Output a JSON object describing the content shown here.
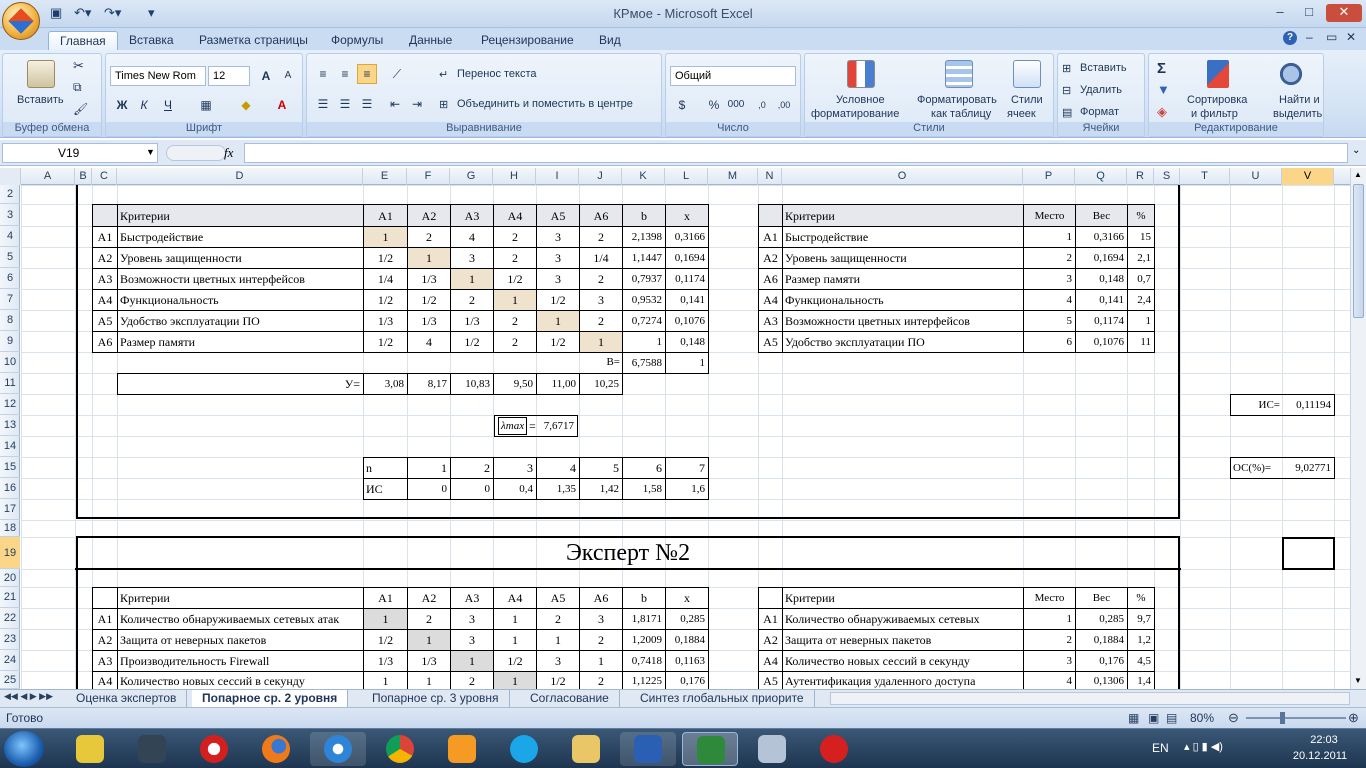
{
  "window": {
    "title": "КРмое - Microsoft Excel"
  },
  "ribbon": {
    "tabs": [
      "Главная",
      "Вставка",
      "Разметка страницы",
      "Формулы",
      "Данные",
      "Рецензирование",
      "Вид"
    ],
    "clipboard": {
      "paste": "Вставить",
      "group": "Буфер обмена"
    },
    "font": {
      "name": "Times New Rom",
      "size": "12",
      "bold": "Ж",
      "italic": "К",
      "underline": "Ч",
      "group": "Шрифт"
    },
    "align": {
      "wrap": "Перенос текста",
      "merge": "Объединить и поместить в центре",
      "group": "Выравнивание"
    },
    "number": {
      "format": "Общий",
      "percent": "%",
      "thousands": "000",
      "group": "Число"
    },
    "styles": {
      "cond1": "Условное",
      "cond2": "форматирование",
      "table1": "Форматировать",
      "table2": "как таблицу",
      "cell1": "Стили",
      "cell2": "ячеек",
      "group": "Стили"
    },
    "cells": {
      "insert": "Вставить",
      "delete": "Удалить",
      "format": "Формат",
      "group": "Ячейки"
    },
    "edit": {
      "sort1": "Сортировка",
      "sort2": "и фильтр",
      "find1": "Найти и",
      "find2": "выделить",
      "group": "Редактирование"
    }
  },
  "formula_bar": {
    "name_box": "V19",
    "fx": "fx",
    "formula": ""
  },
  "columns": [
    "A",
    "B",
    "C",
    "D",
    "E",
    "F",
    "G",
    "H",
    "I",
    "J",
    "K",
    "L",
    "M",
    "N",
    "O",
    "P",
    "Q",
    "R",
    "S",
    "T",
    "U",
    "V"
  ],
  "rows": [
    "2",
    "3",
    "4",
    "5",
    "6",
    "7",
    "8",
    "9",
    "10",
    "11",
    "12",
    "13",
    "14",
    "15",
    "16",
    "17",
    "18",
    "19",
    "20",
    "21",
    "22",
    "23",
    "24",
    "25"
  ],
  "sheet": {
    "matrix1": {
      "headers": [
        "Критерии",
        "A1",
        "A2",
        "A3",
        "A4",
        "A5",
        "A6",
        "b",
        "x"
      ],
      "rows": [
        {
          "id": "A1",
          "name": "Быстродействие",
          "v": [
            "1",
            "2",
            "4",
            "2",
            "3",
            "2"
          ],
          "b": "2,1398",
          "x": "0,3166"
        },
        {
          "id": "A2",
          "name": "Уровень защищенности",
          "v": [
            "1/2",
            "1",
            "3",
            "2",
            "3",
            "1/4"
          ],
          "b": "1,1447",
          "x": "0,1694"
        },
        {
          "id": "A3",
          "name": "Возможности цветных интерфейсов",
          "v": [
            "1/4",
            "1/3",
            "1",
            "1/2",
            "3",
            "2"
          ],
          "b": "0,7937",
          "x": "0,1174"
        },
        {
          "id": "A4",
          "name": "Функциональность",
          "v": [
            "1/2",
            "1/2",
            "2",
            "1",
            "1/2",
            "3"
          ],
          "b": "0,9532",
          "x": "0,141"
        },
        {
          "id": "A5",
          "name": "Удобство эксплуатации ПО",
          "v": [
            "1/3",
            "1/3",
            "1/3",
            "2",
            "1",
            "2"
          ],
          "b": "0,7274",
          "x": "0,1076"
        },
        {
          "id": "A6",
          "name": "Размер памяти",
          "v": [
            "1/2",
            "4",
            "1/2",
            "2",
            "1/2",
            "1"
          ],
          "b": "1",
          "x": "0,148"
        }
      ],
      "b_label": "B=",
      "b_sum": "6,7588",
      "x_sum": "1",
      "y_label": "У=",
      "y": [
        "3,08",
        "8,17",
        "10,83",
        "9,50",
        "11,00",
        "10,25"
      ],
      "lambda_label": "λmax",
      "lambda_eq": "=",
      "lambda_val": "7,6717"
    },
    "ranking1": {
      "headers": [
        "Критерии",
        "Место",
        "Вес",
        "%"
      ],
      "rows": [
        {
          "id": "A1",
          "name": "Быстродействие",
          "place": "1",
          "w": "0,3166",
          "p": "15"
        },
        {
          "id": "A2",
          "name": "Уровень защищенности",
          "place": "2",
          "w": "0,1694",
          "p": "2,1"
        },
        {
          "id": "A6",
          "name": "Размер памяти",
          "place": "3",
          "w": "0,148",
          "p": "0,7"
        },
        {
          "id": "A4",
          "name": "Функциональность",
          "place": "4",
          "w": "0,141",
          "p": "2,4"
        },
        {
          "id": "A3",
          "name": "Возможности цветных интерфейсов",
          "place": "5",
          "w": "0,1174",
          "p": "1"
        },
        {
          "id": "A5",
          "name": "Удобство эксплуатации ПО",
          "place": "6",
          "w": "0,1076",
          "p": "11"
        }
      ]
    },
    "is_table": {
      "n_label": "n",
      "n": [
        "1",
        "2",
        "3",
        "4",
        "5",
        "6",
        "7"
      ],
      "is_label": "ИС",
      "is": [
        "0",
        "0",
        "0,4",
        "1,35",
        "1,42",
        "1,58",
        "1,6"
      ]
    },
    "is_val": {
      "label": "ИС=",
      "value": "0,11194"
    },
    "os_val": {
      "label": "ОС(%)=",
      "value": "9,02771"
    },
    "expert2": {
      "title": "Эксперт №2"
    },
    "matrix2": {
      "headers": [
        "Критерии",
        "A1",
        "A2",
        "A3",
        "A4",
        "A5",
        "A6",
        "b",
        "x"
      ],
      "rows": [
        {
          "id": "A1",
          "name": "Количество обнаруживаемых сетевых атак",
          "v": [
            "1",
            "2",
            "3",
            "1",
            "2",
            "3"
          ],
          "b": "1,8171",
          "x": "0,285"
        },
        {
          "id": "A2",
          "name": "Защита от неверных пакетов",
          "v": [
            "1/2",
            "1",
            "3",
            "1",
            "1",
            "2"
          ],
          "b": "1,2009",
          "x": "0,1884"
        },
        {
          "id": "A3",
          "name": "Производительность Firewall",
          "v": [
            "1/3",
            "1/3",
            "1",
            "1/2",
            "3",
            "1"
          ],
          "b": "0,7418",
          "x": "0,1163"
        },
        {
          "id": "A4",
          "name": "Количество новых сессий в секунду",
          "v": [
            "1",
            "1",
            "2",
            "1",
            "1/2",
            "2"
          ],
          "b": "1,1225",
          "x": "0,176"
        }
      ]
    },
    "ranking2": {
      "headers": [
        "Критерии",
        "Место",
        "Вес",
        "%"
      ],
      "rows": [
        {
          "id": "A1",
          "name": "Количество обнаруживаемых сетевых",
          "place": "1",
          "w": "0,285",
          "p": "9,7"
        },
        {
          "id": "A2",
          "name": "Защита от неверных пакетов",
          "place": "2",
          "w": "0,1884",
          "p": "1,2"
        },
        {
          "id": "A4",
          "name": "Количество новых сессий в секунду",
          "place": "3",
          "w": "0,176",
          "p": "4,5"
        },
        {
          "id": "A5",
          "name": "Аутентификация удаленного доступа",
          "place": "4",
          "w": "0,1306",
          "p": "1,4"
        }
      ]
    }
  },
  "sheet_tabs": [
    "Оценка экспертов",
    "Попарное ср. 2 уровня",
    "Попарное ср. 3 уровня",
    "Согласование",
    "Синтез глобальных приорите"
  ],
  "active_sheet": 1,
  "status": {
    "ready": "Готово",
    "zoom": "80%"
  },
  "taskbar": {
    "lang": "EN",
    "time": "22:03",
    "date": "20.12.2011"
  }
}
